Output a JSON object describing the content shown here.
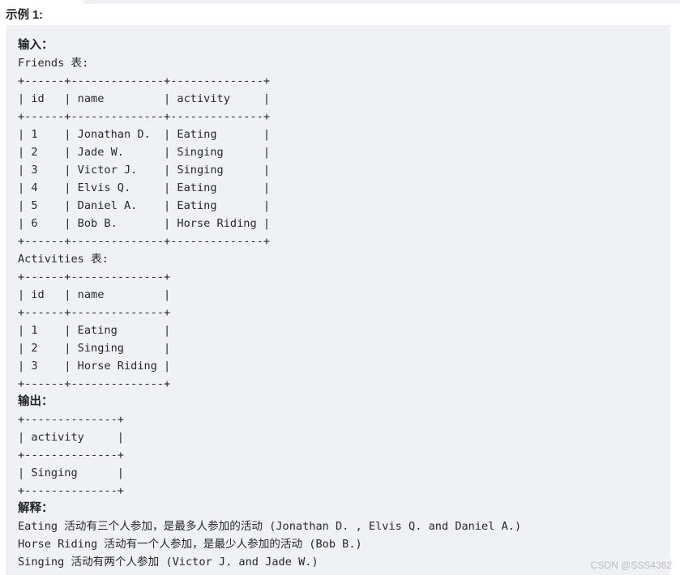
{
  "page": {
    "example_title": "示例 1:",
    "watermark": "CSDN @SSS4362",
    "colors": {
      "code_background": "#f0f1f4",
      "page_background": "#ffffff",
      "text": "#24292f",
      "heading": "#1f2328",
      "watermark": "#b9bec4"
    }
  },
  "code": {
    "input_heading": "输入：",
    "friends_table_label": "Friends 表:",
    "friends_table": {
      "border": "+------+--------------+--------------+",
      "header": "| id   | name         | activity     |",
      "rows": [
        "| 1    | Jonathan D.  | Eating       |",
        "| 2    | Jade W.      | Singing      |",
        "| 3    | Victor J.    | Singing      |",
        "| 4    | Elvis Q.     | Eating       |",
        "| 5    | Daniel A.    | Eating       |",
        "| 6    | Bob B.       | Horse Riding |"
      ]
    },
    "activities_table_label": "Activities 表:",
    "activities_table": {
      "border": "+------+--------------+",
      "header": "| id   | name         |",
      "rows": [
        "| 1    | Eating       |",
        "| 2    | Singing      |",
        "| 3    | Horse Riding |"
      ]
    },
    "output_heading": "输出：",
    "output_table": {
      "border": "+--------------+",
      "header": "| activity     |",
      "rows": [
        "| Singing      |"
      ]
    },
    "explanation_heading": "解释：",
    "explanation_lines": [
      "Eating 活动有三个人参加，是最多人参加的活动 (Jonathan D. , Elvis Q. and Daniel A.)",
      "Horse Riding 活动有一个人参加，是最少人参加的活动 (Bob B.)",
      "Singing 活动有两个人参加 (Victor J. and Jade W.)"
    ]
  }
}
